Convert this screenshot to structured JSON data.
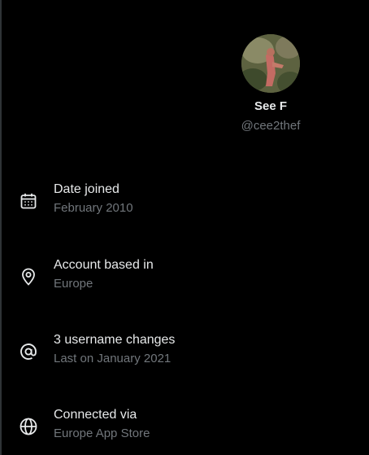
{
  "profile": {
    "display_name": "See F",
    "handle": "@cee2thef"
  },
  "info_rows": [
    {
      "icon": "calendar-icon",
      "title": "Date joined",
      "subtitle": "February 2010"
    },
    {
      "icon": "location-pin-icon",
      "title": "Account based in",
      "subtitle": "Europe"
    },
    {
      "icon": "at-sign-icon",
      "title": "3 username changes",
      "subtitle": "Last on January 2021"
    },
    {
      "icon": "globe-icon",
      "title": "Connected via",
      "subtitle": "Europe App Store"
    }
  ],
  "colors": {
    "background": "#000000",
    "primary_text": "#e7e9ea",
    "secondary_text": "#71767b",
    "divider": "#2f3336"
  }
}
